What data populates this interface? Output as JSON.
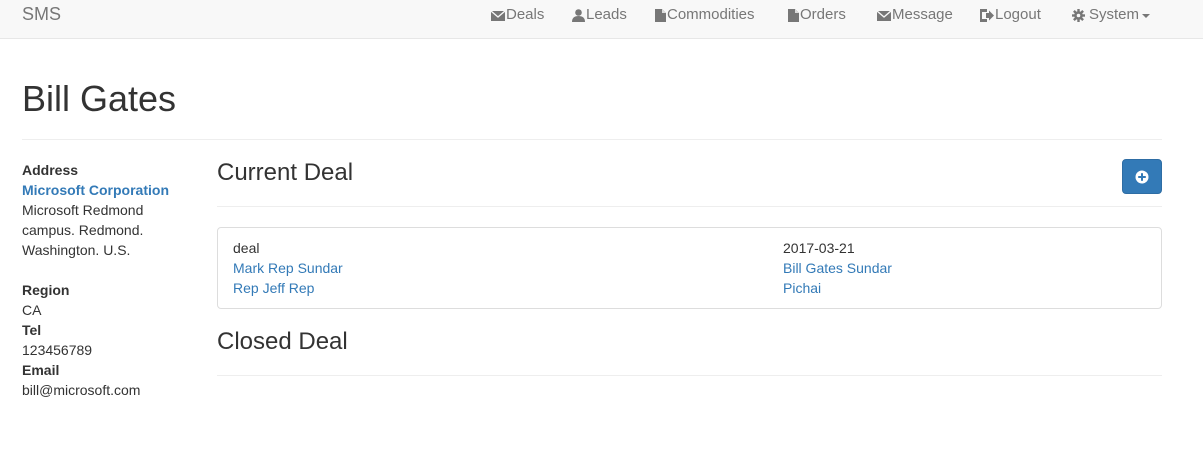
{
  "navbar": {
    "brand": "SMS",
    "items": [
      {
        "label": "Deals",
        "icon": "envelope-icon"
      },
      {
        "label": "Leads",
        "icon": "user-icon"
      },
      {
        "label": "Commodities",
        "icon": "file-icon"
      },
      {
        "label": "Orders",
        "icon": "file-icon"
      },
      {
        "label": "Message",
        "icon": "envelope-icon"
      },
      {
        "label": "Logout",
        "icon": "logout-icon"
      },
      {
        "label": "System",
        "icon": "gear-icon"
      }
    ]
  },
  "page": {
    "title": "Bill Gates"
  },
  "sidebar": {
    "address_label": "Address",
    "company": "Microsoft Corporation",
    "address_lines": [
      "Microsoft Redmond",
      "campus. Redmond.",
      "Washington. U.S."
    ],
    "region_label": "Region",
    "region": "CA",
    "tel_label": "Tel",
    "tel": "123456789",
    "email_label": "Email",
    "email": "bill@microsoft.com"
  },
  "current_deal": {
    "title": "Current Deal",
    "add_button_icon": "plus-circle-icon",
    "deal": {
      "name": "deal",
      "date": "2017-03-21",
      "links_left": [
        "Mark Rep Sundar",
        "Rep Jeff Rep"
      ],
      "links_right": [
        "Bill Gates Sundar",
        "Pichai"
      ]
    }
  },
  "closed_deal": {
    "title": "Closed Deal"
  },
  "colors": {
    "link": "#337ab7",
    "navbar_bg": "#f8f8f8",
    "button": "#337ab7"
  }
}
